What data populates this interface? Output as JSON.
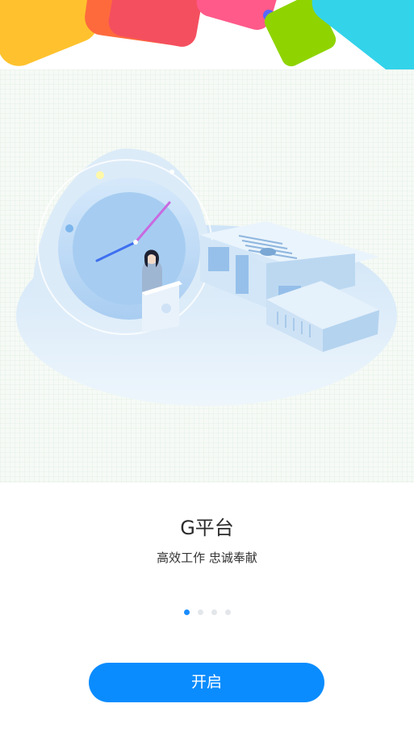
{
  "app": {
    "title": "G平台",
    "slogan": "高效工作 忠诚奉献"
  },
  "pager": {
    "total": 4,
    "current": 1
  },
  "start_button": {
    "label": "开启"
  },
  "colors": {
    "accent": "#0a8cff",
    "dot_inactive": "#e3e6ea",
    "deco_yellow": "#ffc22e",
    "deco_orange": "#ff6a3d",
    "deco_pink": "#ff5a8a",
    "deco_green": "#8fd400",
    "deco_cyan": "#33d3ea"
  },
  "icons": {
    "illustration": "clock-and-office-building-illustration"
  }
}
